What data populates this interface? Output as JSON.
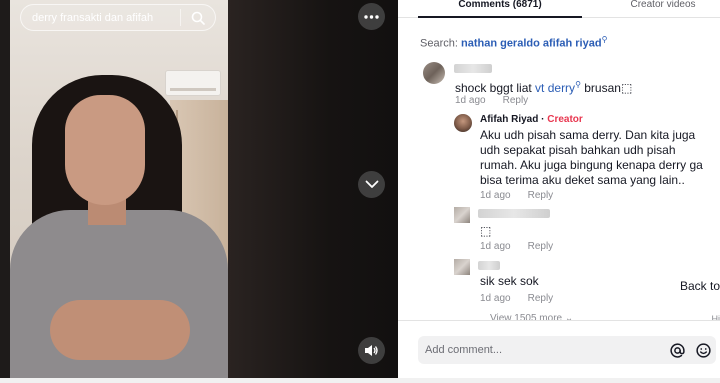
{
  "video": {
    "search_text": "derry fransakti dan afifah",
    "more_icon": "more-horizontal-icon",
    "down_icon": "chevron-down-icon",
    "volume_icon": "volume-icon"
  },
  "tabs": [
    {
      "label": "Comments (6871)",
      "active": true
    },
    {
      "label": "Creator videos",
      "active": false
    }
  ],
  "search_line": {
    "prefix": "Search:",
    "query": "nathan geraldo afifah riyad"
  },
  "comments": [
    {
      "text_before": "shock bggt liat ",
      "link": "vt derry",
      "text_after": " brusan⬚",
      "time": "1d ago",
      "reply_label": "Reply"
    }
  ],
  "replies": [
    {
      "author": "Afifah Riyad",
      "separator": " · ",
      "badge": "Creator",
      "text": "Aku udh pisah sama derry. Dan kita juga udh sepakat pisah bahkan udh pisah rumah. Aku juga bingung kenapa derry ga bisa terima aku deket sama yang lain..",
      "time": "1d ago",
      "reply_label": "Reply"
    },
    {
      "text": "⬚",
      "time": "1d ago",
      "reply_label": "Reply"
    },
    {
      "text": "sik sek sok",
      "time": "1d ago",
      "reply_label": "Reply"
    }
  ],
  "view_more": "View 1505 more",
  "back_to": "Back to",
  "hi_text": "Hi",
  "composer": {
    "placeholder": "Add comment...",
    "mention_icon": "at-sign-icon",
    "emoji_icon": "emoji-icon"
  }
}
